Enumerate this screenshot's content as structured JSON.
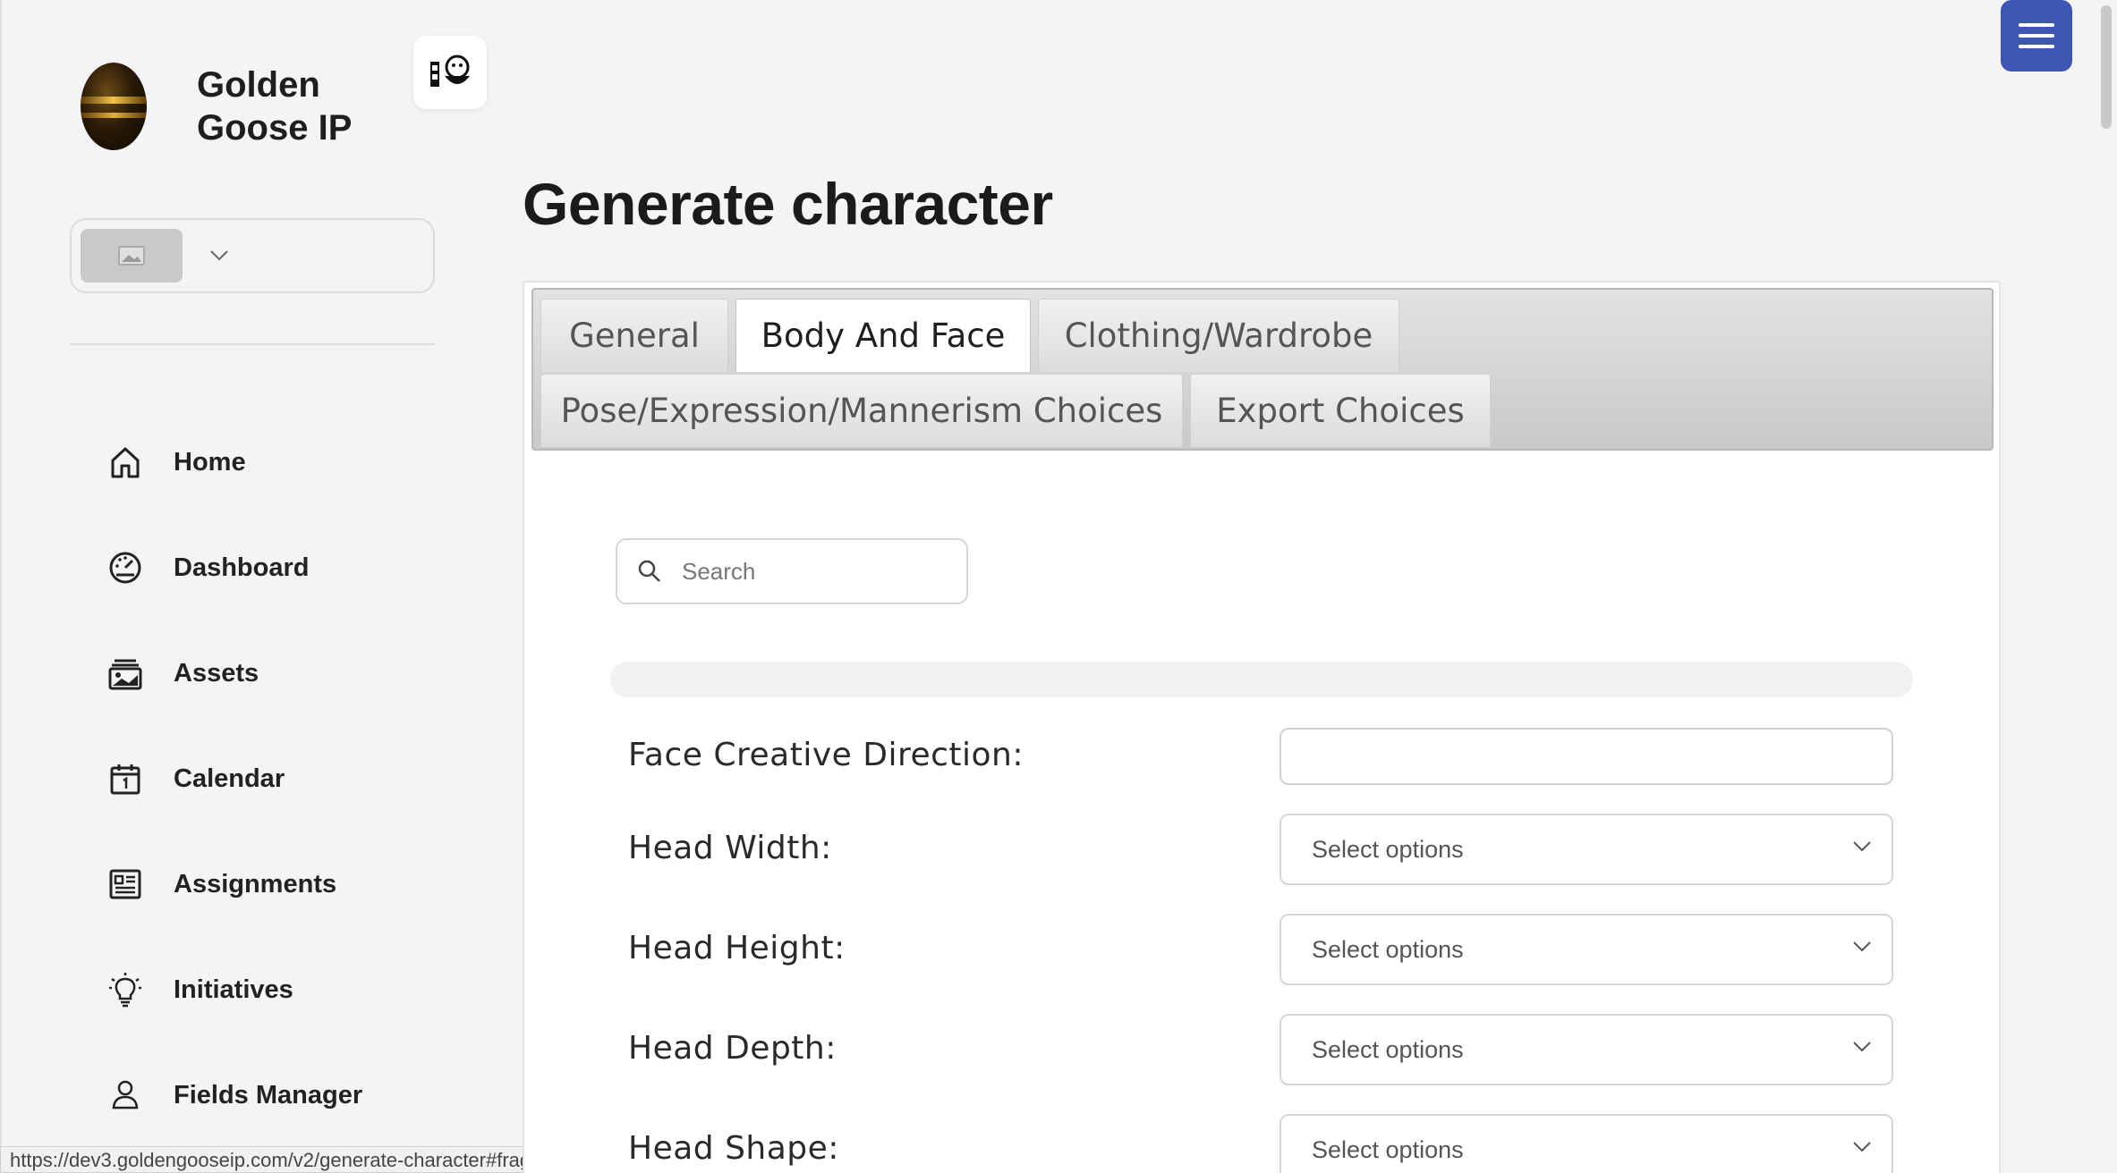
{
  "brand": {
    "name": "Golden Goose IP"
  },
  "sidebar": {
    "items": [
      {
        "label": "Home",
        "icon": "home-icon"
      },
      {
        "label": "Dashboard",
        "icon": "gauge-icon"
      },
      {
        "label": "Assets",
        "icon": "image-stack-icon"
      },
      {
        "label": "Calendar",
        "icon": "calendar-icon"
      },
      {
        "label": "Assignments",
        "icon": "list-icon"
      },
      {
        "label": "Initiatives",
        "icon": "lightbulb-icon"
      },
      {
        "label": "Fields Manager",
        "icon": "user-icon"
      }
    ]
  },
  "status_url": "https://dev3.goldengooseip.com/v2/generate-character#fragmen...",
  "main": {
    "title": "Generate character",
    "tabs": [
      {
        "label": "General"
      },
      {
        "label": "Body And Face"
      },
      {
        "label": "Clothing/Wardrobe"
      },
      {
        "label": "Pose/Expression/Mannerism Choices"
      },
      {
        "label": "Export Choices"
      }
    ],
    "active_tab": "Body And Face",
    "search": {
      "placeholder": "Search",
      "value": ""
    },
    "form": {
      "face_direction_label": "Face Creative Direction:",
      "face_direction_value": "",
      "fields": [
        {
          "label": "Head Width:",
          "value": "Select options"
        },
        {
          "label": "Head Height:",
          "value": "Select options"
        },
        {
          "label": "Head Depth:",
          "value": "Select options"
        },
        {
          "label": "Head Shape:",
          "value": "Select options"
        }
      ]
    }
  },
  "colors": {
    "accent": "#3d56b2",
    "background": "#f4f4f6"
  }
}
